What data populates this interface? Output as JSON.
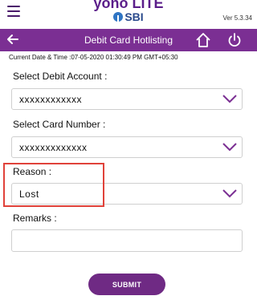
{
  "app": {
    "brand_top": "yono LITE",
    "brand_bottom": "SBI",
    "version": "Ver 5.3.34"
  },
  "header": {
    "title": "Debit Card Hotlisting"
  },
  "info": {
    "datetime": "Current Date & Time :07-05-2020 01:30:49 PM GMT+05:30"
  },
  "form": {
    "debit_account": {
      "label": "Select Debit Account :",
      "value": "xxxxxxxxxxxx"
    },
    "card_number": {
      "label": "Select Card Number :",
      "value": "xxxxxxxxxxxxx"
    },
    "reason": {
      "label": "Reason :",
      "value": "Lost"
    },
    "remarks": {
      "label": "Remarks :",
      "value": "",
      "placeholder": ""
    },
    "submit_label": "SUBMIT"
  },
  "colors": {
    "primary": "#7b2f93",
    "button": "#6f2a84",
    "highlight": "#e0423a"
  },
  "icons": {
    "menu": "hamburger-icon",
    "back": "back-arrow-icon",
    "home": "home-icon",
    "logout": "power-icon",
    "dropdown": "chevron-down-icon"
  }
}
